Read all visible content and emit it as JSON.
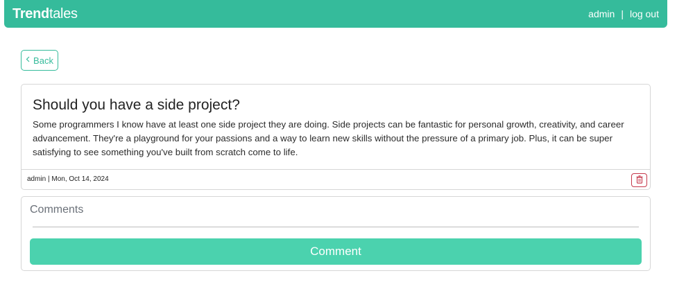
{
  "navbar": {
    "brand_bold": "Trend",
    "brand_light": "tales",
    "user": "admin",
    "separator": "|",
    "logout": "log out"
  },
  "back_button": {
    "icon": "chevron-left-icon",
    "label": "Back"
  },
  "post": {
    "title": "Should you have a side project?",
    "body": "Some programmers I know have at least one side project they are doing. Side projects can be fantastic for personal growth, creativity, and career advancement. They're a playground for your passions and a way to learn new skills without the pressure of a primary job. Plus, it can be super satisfying to see something you've built from scratch come to life.",
    "meta": "admin | Mon, Oct 14, 2024",
    "delete_icon": "trash-icon"
  },
  "comments": {
    "label": "Comments",
    "input_value": "",
    "button_label": "Comment"
  },
  "colors": {
    "navbar": "#35bb9b",
    "accent": "#35bb9b",
    "comment_button": "#4bd2ae",
    "delete": "#c5374a"
  }
}
